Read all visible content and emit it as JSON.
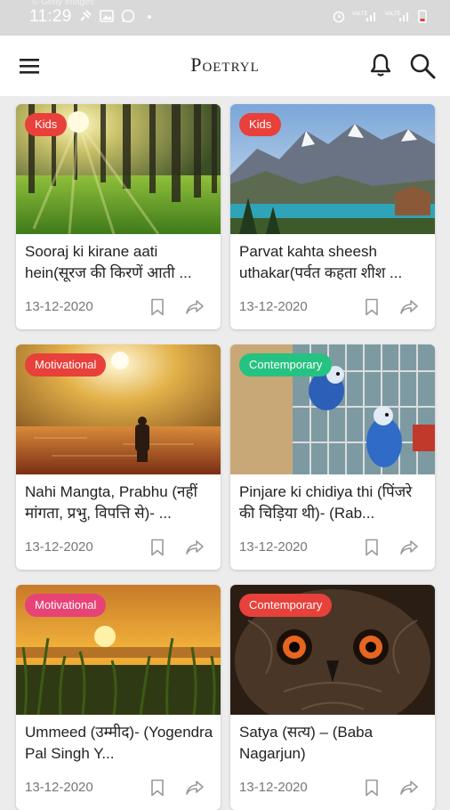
{
  "status_bar": {
    "watermark": "© Getty Images",
    "time": "11:29",
    "left_icons": [
      "satellite-icon",
      "image-icon",
      "whatsapp-icon",
      "dot-icon"
    ],
    "right_icons": [
      "alarm-icon",
      "volte-signal-icon",
      "volte-signal-icon",
      "battery-icon"
    ]
  },
  "app_bar": {
    "title": "Poetryl",
    "menu_icon": "hamburger-menu-icon",
    "bell_icon": "bell-icon",
    "search_icon": "search-icon"
  },
  "colors": {
    "kids": "#e8403b",
    "motivational_red": "#e8403b",
    "motivational_pink": "#e84377",
    "contemporary_green": "#26c281",
    "contemporary_red": "#e8403b"
  },
  "cards": [
    {
      "category": "Kids",
      "badge_color": "#e8403b",
      "title": "Sooraj ki kirane aati hein(सूरज की किरणें आती ...",
      "date": "13-12-2020",
      "image": "forest-sunlight-image"
    },
    {
      "category": "Kids",
      "badge_color": "#e8403b",
      "title": "Parvat kahta sheesh uthakar(पर्वत कहता शीश ...",
      "date": "13-12-2020",
      "image": "mountain-lake-image"
    },
    {
      "category": "Motivational",
      "badge_color": "#e8403b",
      "title": "Nahi Mangta, Prabhu (नहीं मांगता, प्रभु, विपत्ति से)- ...",
      "date": "13-12-2020",
      "image": "man-in-water-sunset-image"
    },
    {
      "category": "Contemporary",
      "badge_color": "#26c281",
      "title": "Pinjare ki chidiya thi (पिंजरे की चिड़िया थी)- (Rab...",
      "date": "13-12-2020",
      "image": "parakeets-cage-image"
    },
    {
      "category": "Motivational",
      "badge_color": "#e84377",
      "title": "Ummeed (उम्मीद)- (Yogendra Pal Singh Y...",
      "date": "13-12-2020",
      "image": "grass-sunset-image"
    },
    {
      "category": "Contemporary",
      "badge_color": "#e8403b",
      "title": "Satya (सत्य) – (Baba Nagarjun)",
      "date": "13-12-2020",
      "image": "owl-face-image"
    }
  ]
}
